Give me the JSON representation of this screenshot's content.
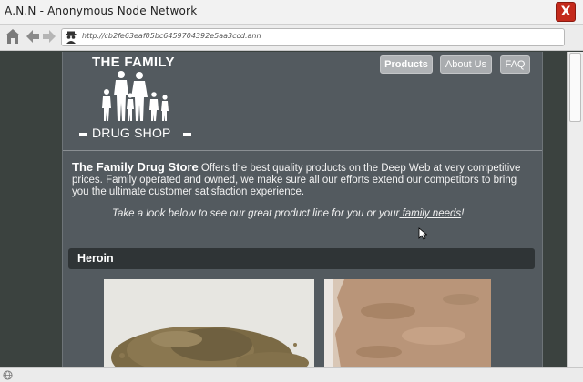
{
  "window": {
    "title": "A.N.N - Anonymous Node Network",
    "close_label": "X"
  },
  "navbar": {
    "home_icon": "home-icon",
    "back_icon": "back-arrow-icon",
    "forward_icon": "forward-arrow-icon",
    "spy_icon": "spy-icon",
    "url": "http://cb2fe63eaf05bc6459704392e5aa3ccd.ann"
  },
  "site": {
    "logo_line1": "THE FAMILY",
    "logo_line2": "DRUG SHOP",
    "menu": [
      {
        "label": "Products",
        "active": true
      },
      {
        "label": "About Us",
        "active": false
      },
      {
        "label": "FAQ",
        "active": false
      }
    ],
    "intro_lead": "The Family Drug Store",
    "intro_text": " Offers the best quality products on the Deep Web at very competitive prices. Family operated and owned, we make sure all our efforts extend our competitors to bring you the ultimate customer satisfaction experience.",
    "tagline_text": "Take a look below to see our great product line for you or your",
    "tagline_link": " family needs",
    "tagline_end": "!",
    "section_title": "Heroin"
  },
  "colors": {
    "page_bg": "#535a5f",
    "section_bar": "#2f3436",
    "close_red": "#c42a1c"
  }
}
